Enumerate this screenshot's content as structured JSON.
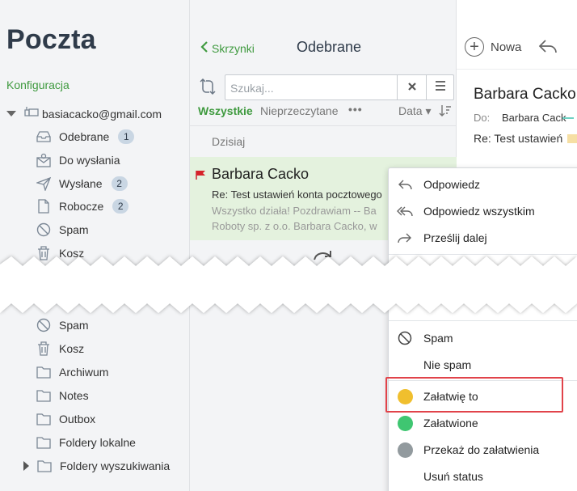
{
  "sidebar": {
    "app_title": "Poczta",
    "config_link": "Konfiguracja",
    "account": "basiacacko@gmail.com",
    "folders_top": [
      {
        "label": "Odebrane",
        "icon": "inbox-icon",
        "badge": "1"
      },
      {
        "label": "Do wysłania",
        "icon": "outbox-person-icon",
        "badge": ""
      },
      {
        "label": "Wysłane",
        "icon": "send-icon",
        "badge": "2"
      },
      {
        "label": "Robocze",
        "icon": "draft-icon",
        "badge": "2"
      },
      {
        "label": "Spam",
        "icon": "spam-icon",
        "badge": ""
      },
      {
        "label": "Kosz",
        "icon": "trash-icon",
        "badge": ""
      }
    ],
    "folders_bottom": [
      {
        "label": "Spam",
        "icon": "spam-icon"
      },
      {
        "label": "Kosz",
        "icon": "trash-icon"
      },
      {
        "label": "Archiwum",
        "icon": "folder-icon"
      },
      {
        "label": "Notes",
        "icon": "folder-icon"
      },
      {
        "label": "Outbox",
        "icon": "folder-icon"
      },
      {
        "label": "Foldery lokalne",
        "icon": "folder-icon"
      },
      {
        "label": "Foldery wyszukiwania",
        "icon": "folder-icon"
      }
    ]
  },
  "list": {
    "back_label": "Skrzynki",
    "title": "Odebrane",
    "search_placeholder": "Szukaj...",
    "filter_all": "Wszystkie",
    "filter_unread": "Nieprzeczytane",
    "filter_more": "•••",
    "sort_label": "Data ▾",
    "group_label": "Dzisiaj",
    "message": {
      "sender": "Barbara Cacko",
      "subject": "Re: Test ustawień konta pocztowego",
      "preview_line1": "Wszystko działa! Pozdrawiam -- Ba",
      "preview_line2": "Roboty sp. z o.o. Barbara Cacko, w"
    }
  },
  "reader": {
    "new_label": "Nowa",
    "from": "Barbara Cacko",
    "to_label": "Do:",
    "to_value": "Barbara Cack",
    "subject": "Re: Test ustawień"
  },
  "context_menu": {
    "items": [
      {
        "label": "Odpowiedz",
        "icon": "reply-icon"
      },
      {
        "label": "Odpowiedz wszystkim",
        "icon": "reply-all-icon"
      },
      {
        "label": "Prześlij dalej",
        "icon": "forward-icon"
      },
      {
        "label": "Spam",
        "icon": "spam-icon"
      },
      {
        "label": "Nie spam",
        "icon": ""
      },
      {
        "label": "Załatwię to",
        "icon": "status-dot-yellow-icon",
        "color": "#f0bf2e"
      },
      {
        "label": "Załatwione",
        "icon": "status-dot-green-icon",
        "color": "#3fc671"
      },
      {
        "label": "Przekaż do załatwienia",
        "icon": "status-dot-gray-icon",
        "color": "#929a9e"
      },
      {
        "label": "Usuń status",
        "icon": ""
      }
    ]
  },
  "colors": {
    "accent_green": "#3f9a3f",
    "highlight_red": "#e1434a",
    "selected_row": "#e4f2de",
    "badge_bg": "#c9d6e3"
  }
}
